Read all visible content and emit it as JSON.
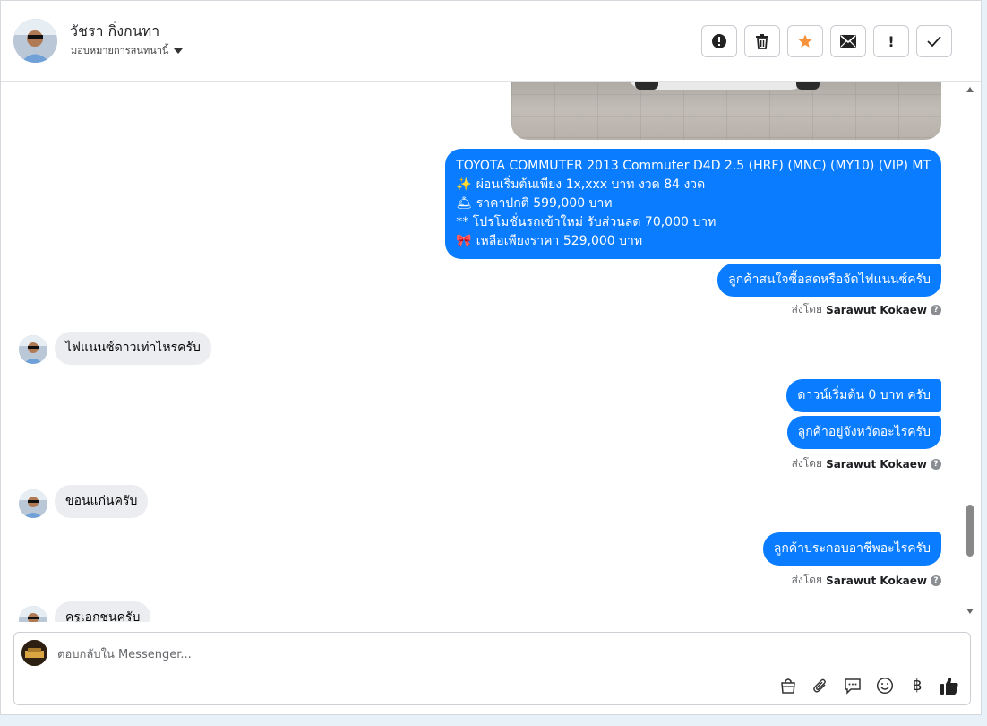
{
  "header": {
    "contact_name": "วัชรา กิ่งกนทา",
    "assign_label": "มอบหมายการสนทนานี้",
    "actions": [
      {
        "name": "spam-button",
        "icon": "alert-circle-icon"
      },
      {
        "name": "delete-button",
        "icon": "trash-icon"
      },
      {
        "name": "star-button",
        "icon": "star-icon",
        "color": "#f7923a"
      },
      {
        "name": "mark-unread-button",
        "icon": "envelope-icon"
      },
      {
        "name": "follow-up-button",
        "icon": "exclamation-icon",
        "glyph": "!"
      },
      {
        "name": "done-button",
        "icon": "check-icon"
      }
    ]
  },
  "messages": {
    "product_post": {
      "line1": "TOYOTA COMMUTER 2013 Commuter D4D 2.5 (HRF) (MNC) (MY10) (VIP) MT",
      "line2_emoji": "✨",
      "line2": "ผ่อนเริ่มต้นเพียง 1x,xxx บาท งวด 84 งวด",
      "line3_emoji": "🛎",
      "line3": "ราคาปกติ 599,000 บาท",
      "line4": "** โปรโมชั่นรถเข้าใหม่ รับส่วนลด 70,000 บาท",
      "line5_emoji": "🎀",
      "line5": "เหลือเพียงราคา 529,000 บาท"
    },
    "out_1": "ลูกค้าสนใจซื้อสดหรือจัดไฟแนนซ์ครับ",
    "sent_by_label": "ส่งโดย",
    "agent_name": "Sarawut Kokaew",
    "in_1": "ไฟแนนซ์ดาวเท่าไหร่ครับ",
    "out_2": "ดาวน์เริ่มต้น 0 บาท ครับ",
    "out_3": "ลูกค้าอยู่จังหวัดอะไรครับ",
    "in_2": "ขอนแก่นครับ",
    "out_4": "ลูกค้าประกอบอาชีพอะไรครับ",
    "in_3": "ครูเอกชนครับ"
  },
  "composer": {
    "placeholder": "ตอบกลับใน Messenger...",
    "tools": [
      "bag-icon",
      "paperclip-icon",
      "speech-bubble-icon",
      "smiley-icon",
      "baht-icon",
      "thumbs-up-icon"
    ],
    "baht_glyph": "฿"
  },
  "colors": {
    "outgoing_bubble": "#0a7cff",
    "incoming_bubble": "#ebedf0",
    "star": "#f7923a"
  }
}
